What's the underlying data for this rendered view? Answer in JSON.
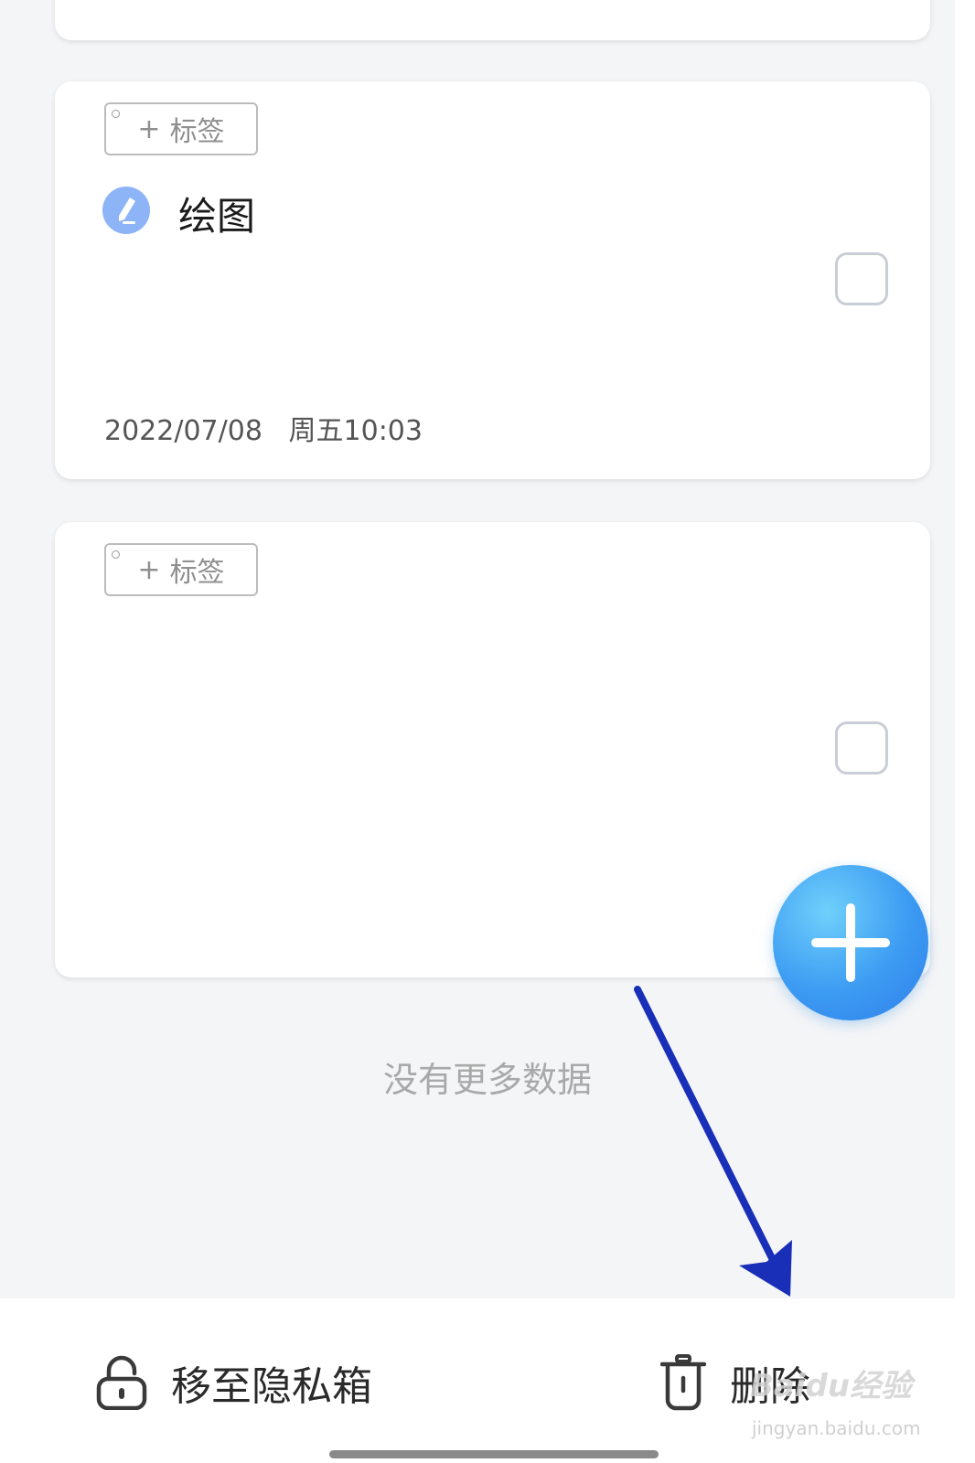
{
  "notes": [
    {
      "tag_label": "标签",
      "tag_plus": "+",
      "title": "绘图",
      "date": "2022/07/08",
      "time": "周五10:03",
      "icon": "pen-icon"
    },
    {
      "tag_label": "标签",
      "tag_plus": "+",
      "title": "",
      "date": "",
      "time": ""
    }
  ],
  "fab": {
    "icon": "plus-icon"
  },
  "list_footer": "没有更多数据",
  "bottom_bar": {
    "move_private_label": "移至隐私箱",
    "move_private_icon": "lock-icon",
    "delete_label": "删除",
    "delete_icon": "trash-icon"
  },
  "watermark": {
    "logo": "Baidu经验",
    "url": "jingyan.baidu.com"
  },
  "colors": {
    "background": "#f4f5f7",
    "card": "#ffffff",
    "fab_blue": "#3c9bf2",
    "arrow_blue": "#1a2fb8",
    "note_icon_blue": "#8db4f7"
  }
}
